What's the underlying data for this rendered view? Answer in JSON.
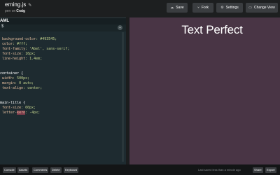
{
  "header": {
    "pen_title": "erning.js",
    "author_prefix": "pen on",
    "author_name": "Craig",
    "buttons": {
      "save": "Save",
      "fork": "Fork",
      "settings": "Settings",
      "change_view": "Change View"
    }
  },
  "editor": {
    "language": "AML",
    "code_lines": [
      {
        "sel": "",
        "prop": "",
        "val": ""
      },
      {
        "sel": "",
        "prop": " background-color",
        "val": ": #493545;"
      },
      {
        "sel": "",
        "prop": " color",
        "val": ": #fff;"
      },
      {
        "sel": "",
        "prop": " font-family",
        "val": ": 'Abel', sans-serif;"
      },
      {
        "sel": "",
        "prop": " font-size",
        "val": ": 16px;"
      },
      {
        "sel": "",
        "prop": " line-height",
        "val": ": 1.4em;"
      },
      {
        "sel": "",
        "prop": "",
        "val": ""
      },
      {
        "sel": "",
        "prop": "",
        "val": ""
      },
      {
        "sel": "container {",
        "prop": "",
        "val": ""
      },
      {
        "sel": "",
        "prop": " width",
        "val": ": 500px;"
      },
      {
        "sel": "",
        "prop": " margin",
        "val": ": 0 auto;"
      },
      {
        "sel": "",
        "prop": " text-align",
        "val": ": center;"
      },
      {
        "sel": "",
        "prop": "",
        "val": ""
      },
      {
        "sel": "",
        "prop": "",
        "val": ""
      },
      {
        "sel": "main-title {",
        "prop": "",
        "val": ""
      },
      {
        "sel": "",
        "prop": " font-size",
        "val": ": 60px;"
      },
      {
        "sel": "",
        "prop": " letter-",
        "val": ": -4px;"
      }
    ],
    "highlight_word": "kern"
  },
  "preview": {
    "title": "Text Perfect"
  },
  "footer": {
    "buttons": [
      "Console",
      "Assets",
      "Comments",
      "Delete",
      "Keyboard"
    ],
    "status": "Last saved less than a minute ago",
    "share": "Share",
    "export": "Export"
  }
}
